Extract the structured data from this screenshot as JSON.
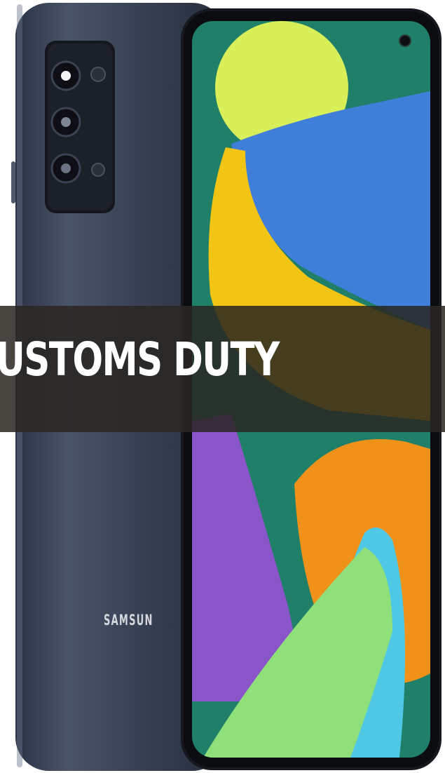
{
  "image": {
    "subject": "Samsung smartphone, back and front view",
    "colors": {
      "phone_back": "#3a4356",
      "screen_bg": "#1f7f68",
      "yellow_circle": "#d9ef5a",
      "blue_shape": "#3f7fd9",
      "yellow_band": "#f2c514",
      "purple_shape": "#8a55c9",
      "orange_shape": "#f0921a",
      "cyan_shape": "#4fc8e6",
      "green_shape": "#8fe07a",
      "banner_bg": "#2a2622"
    }
  },
  "banner": {
    "text": "USTOMS DUTY"
  },
  "phone": {
    "brand_text": "SAMSUN"
  }
}
